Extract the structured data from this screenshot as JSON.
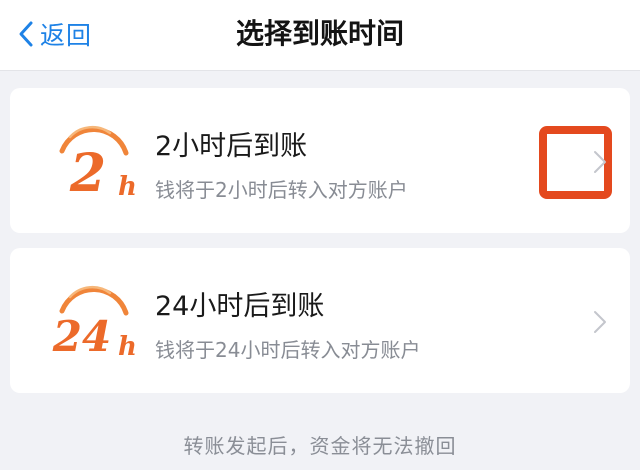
{
  "nav": {
    "back_label": "返回",
    "title": "选择到账时间"
  },
  "options": [
    {
      "logo_number": "2",
      "logo_unit": "h",
      "title": "2小时后到账",
      "description": "钱将于2小时后转入对方账户",
      "icon": "chevron-right-icon",
      "highlighted": true
    },
    {
      "logo_number": "24",
      "logo_unit": "h",
      "title": "24小时后到账",
      "description": "钱将于24小时后转入对方账户",
      "icon": "chevron-right-icon",
      "highlighted": false
    }
  ],
  "footer_note": "转账发起后，资金将无法撤回",
  "colors": {
    "accent_blue": "#1e82e6",
    "logo_orange": "#f0853a",
    "highlight_red": "#e4491e",
    "background": "#f1f2f6"
  }
}
